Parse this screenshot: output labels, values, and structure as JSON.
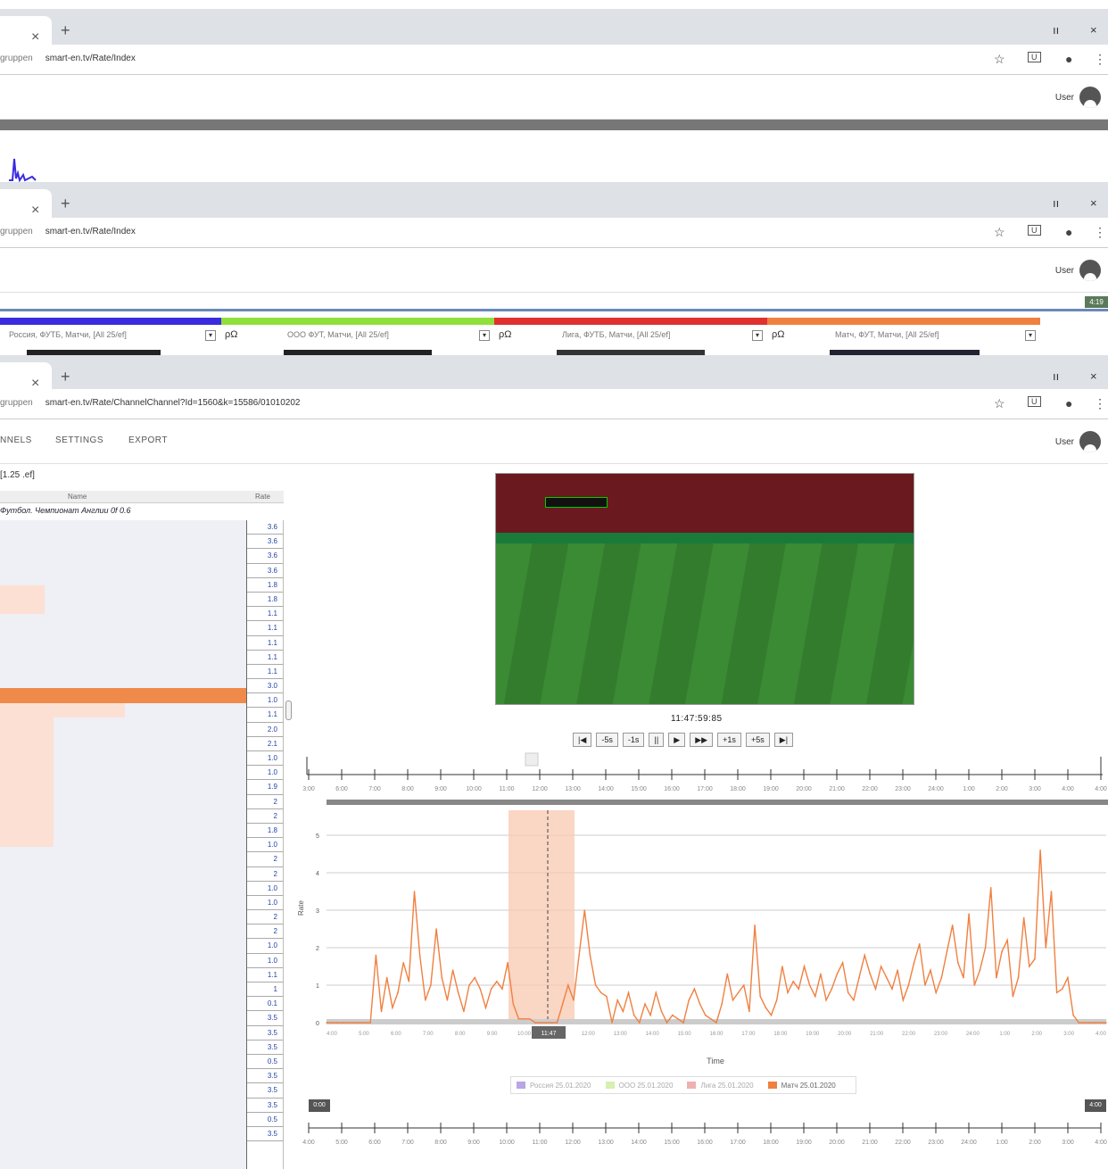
{
  "browser": {
    "tabs": [
      {
        "close": "×",
        "new": "+"
      },
      {
        "close": "×",
        "new": "+"
      },
      {
        "close": "×",
        "new": "+"
      }
    ],
    "window_controls": {
      "min": "ıı",
      "close": "×"
    },
    "urls": [
      {
        "prefix": "gruppen",
        "host": "smart-en.tv/Rate/Index"
      },
      {
        "prefix": "gruppen",
        "host": "smart-en.tv/Rate/Index"
      },
      {
        "prefix": "gruppen",
        "host": "smart-en.tv/Rate/ChannelChannel?Id=1560&k=15586/01010202"
      }
    ],
    "icons": {
      "star": "☆",
      "ext": "U",
      "account": "●",
      "menu": "⋮"
    }
  },
  "app": {
    "user_label": "User",
    "nav": [
      "NNELS",
      "SETTINGS",
      "EXPORT"
    ],
    "badge": "4:19",
    "channels": [
      {
        "label": "Россия, ФУТБ, Матчи, [All 25/ef]",
        "color": "#3a2be0"
      },
      {
        "label": "ООО ФУТ, Матчи, [All 25/ef]",
        "color": "#8fe03a"
      },
      {
        "label": "Лига, ФУТБ, Матчи, [All 25/ef]",
        "color": "#e03030"
      },
      {
        "label": "Матч, ФУТ, Матчи, [All 25/ef]",
        "color": "#f08040"
      }
    ],
    "channel_search": "ρΩ",
    "dropdown_glyph": "▾"
  },
  "sidebar": {
    "crumb": "[1.25 .ef]",
    "col_title": "Name",
    "col_value": "Rate",
    "program": "Футбол. Чемпионат Англии 0f 0.6",
    "values": [
      "3.6",
      "3.6",
      "3.6",
      "3.6",
      "1.8",
      "1.8",
      "1.1",
      "1.1",
      "1.1",
      "1.1",
      "1.1",
      "3.0",
      "1.0",
      "1.1",
      "2.0",
      "2.1",
      "1.0",
      "1.0",
      "1.9",
      "2",
      "2",
      "1.8",
      "1.0",
      "2",
      "2",
      "1.0",
      "1.0",
      "2",
      "2",
      "1.0",
      "1.0",
      "1.1",
      "1",
      "0.1",
      "3.5",
      "3.5",
      "3.5",
      "0.5",
      "3.5",
      "3.5",
      "3.5",
      "0.5",
      "3.5"
    ]
  },
  "player": {
    "timecode": "11:47:59:85",
    "buttons": [
      "|◀",
      "-5s",
      "-1s",
      "||",
      "▶",
      "▶▶",
      "+1s",
      "+5s",
      "▶|"
    ],
    "timeline_ticks": [
      "3:00",
      "6:00",
      "7:00",
      "8:00",
      "9:00",
      "10:00",
      "11:00",
      "12:00",
      "13:00",
      "14:00",
      "15:00",
      "16:00",
      "17:00",
      "18:00",
      "19:00",
      "20:00",
      "21:00",
      "22:00",
      "23:00",
      "24:00",
      "1:00",
      "2:00",
      "3:00",
      "4:00",
      "4:00"
    ]
  },
  "chart_data": {
    "type": "line",
    "title": "",
    "xlabel": "Time",
    "ylabel": "Rate",
    "ylim": [
      0,
      5
    ],
    "yticks": [
      0,
      1,
      2,
      3,
      4,
      5
    ],
    "highlight_label": "11:47",
    "series": [
      {
        "name": "Россия 25.01.2020",
        "color": "#b8a6e6",
        "values": []
      },
      {
        "name": "ООО 25.01.2020",
        "color": "#d6f0b0",
        "values": []
      },
      {
        "name": "Лига 25.01.2020",
        "color": "#f0b0b0",
        "values": []
      },
      {
        "name": "Матч 25.01.2020",
        "color": "#f08040",
        "values": [
          0,
          0,
          0,
          0,
          0,
          0,
          0,
          0,
          0,
          1.8,
          0.3,
          1.2,
          0.4,
          0.8,
          1.6,
          1.1,
          3.5,
          1.8,
          0.6,
          1.0,
          2.5,
          1.2,
          0.6,
          1.4,
          0.8,
          0.3,
          1.0,
          1.2,
          0.9,
          0.4,
          0.9,
          1.1,
          0.9,
          1.6,
          0.5,
          0.1,
          0.1,
          0.1,
          0,
          0,
          0,
          0,
          0,
          0.5,
          1.0,
          0.6,
          1.8,
          3.0,
          1.8,
          1.0,
          0.8,
          0.7,
          0,
          0.6,
          0.3,
          0.8,
          0.2,
          0,
          0.5,
          0.2,
          0.8,
          0.3,
          0,
          0.2,
          0.1,
          0,
          0.6,
          0.9,
          0.5,
          0.2,
          0.1,
          0,
          0.5,
          1.3,
          0.6,
          0.8,
          1.0,
          0.3,
          2.6,
          0.7,
          0.4,
          0.2,
          0.6,
          1.5,
          0.8,
          1.1,
          0.9,
          1.5,
          1.0,
          0.7,
          1.3,
          0.6,
          0.9,
          1.3,
          1.6,
          0.8,
          0.6,
          1.2,
          1.8,
          1.3,
          0.9,
          1.5,
          1.2,
          0.9,
          1.4,
          0.6,
          1.0,
          1.6,
          2.1,
          1.0,
          1.4,
          0.8,
          1.2,
          1.9,
          2.6,
          1.6,
          1.2,
          2.9,
          1.0,
          1.4,
          2.0,
          3.6,
          1.2,
          1.9,
          2.2,
          0.7,
          1.2,
          2.8,
          1.5,
          1.7,
          4.6,
          2.0,
          3.5,
          0.8,
          0.9,
          1.2,
          0.2,
          0,
          0,
          0,
          0,
          0,
          0
        ]
      }
    ],
    "x_ticks_top": [
      "4:00",
      "5:00",
      "6:00",
      "7:00",
      "8:00",
      "9:00",
      "10:00",
      "11:00",
      "12:00",
      "13:00",
      "14:00",
      "15:00",
      "16:00",
      "17:00",
      "18:00",
      "19:00",
      "20:00",
      "21:00",
      "22:00",
      "23:00",
      "24:00",
      "1:00",
      "2:00",
      "3:00",
      "4:00"
    ],
    "range_start": "0:00",
    "range_end": "4:00",
    "range_ticks": [
      "4:00",
      "5:00",
      "6:00",
      "7:00",
      "8:00",
      "9:00",
      "10:00",
      "11:00",
      "12:00",
      "13:00",
      "14:00",
      "15:00",
      "16:00",
      "17:00",
      "18:00",
      "19:00",
      "20:00",
      "21:00",
      "22:00",
      "23:00",
      "24:00",
      "1:00",
      "2:00",
      "3:00",
      "4:00"
    ]
  }
}
